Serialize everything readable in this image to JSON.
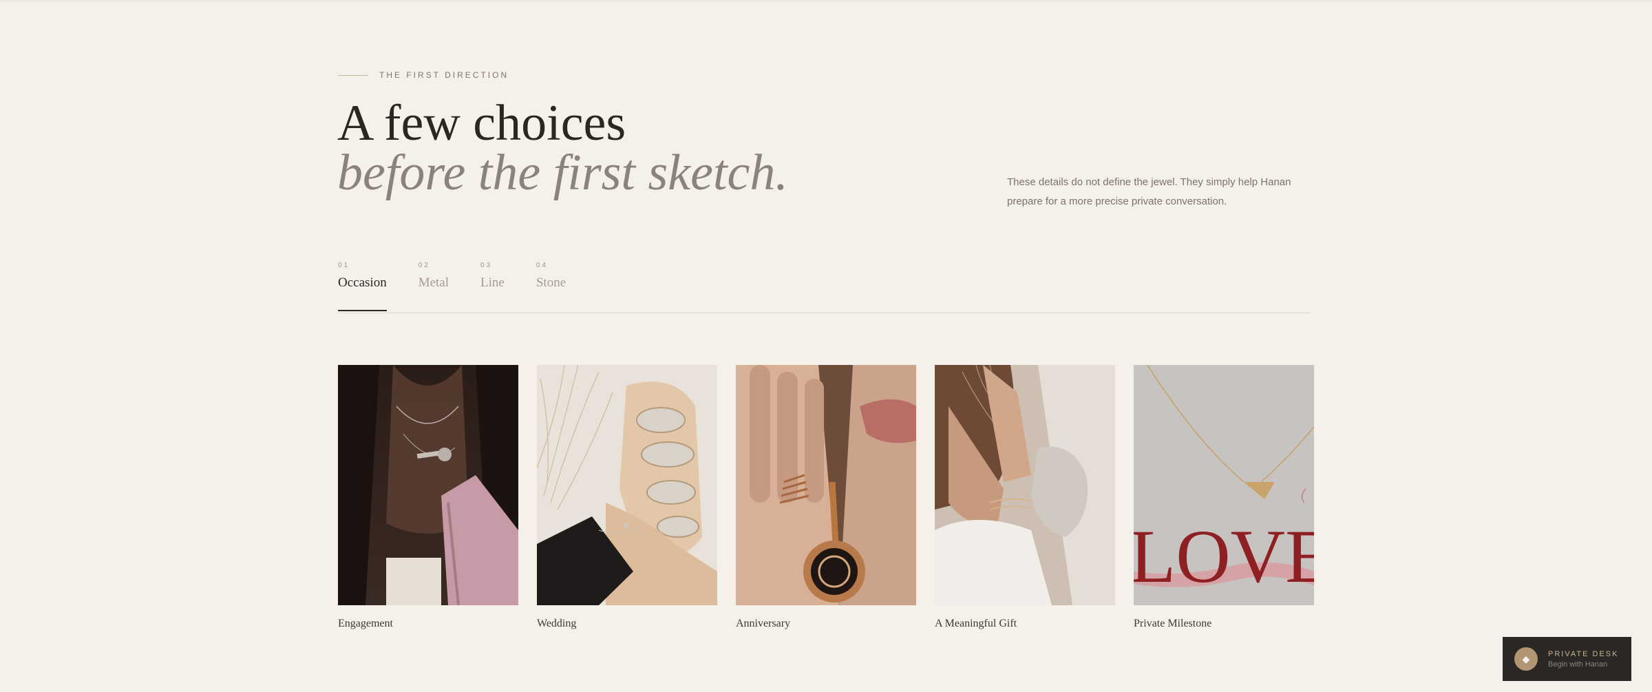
{
  "header": {
    "eyebrow": "THE FIRST DIRECTION",
    "title_line1": "A few choices",
    "title_line2": "before the first sketch.",
    "note": "These details do not define the jewel. They simply help Hanan prepare for a more precise private conversation."
  },
  "tabs": [
    {
      "num": "01",
      "label": "Occasion",
      "active": true
    },
    {
      "num": "02",
      "label": "Metal",
      "active": false
    },
    {
      "num": "03",
      "label": "Line",
      "active": false
    },
    {
      "num": "04",
      "label": "Stone",
      "active": false
    }
  ],
  "cards": [
    {
      "label": "Engagement",
      "image": "necklace-on-dark-sweater-photo"
    },
    {
      "label": "Wedding",
      "image": "anklet-and-sandals-photo"
    },
    {
      "label": "Anniversary",
      "image": "rings-and-watch-pendant-photo"
    },
    {
      "label": "A Meaningful Gift",
      "image": "bracelets-and-dried-grass-photo"
    },
    {
      "label": "Private Milestone",
      "image": "pendant-and-love-print-photo",
      "print_text": "LOVE"
    }
  ],
  "private_desk": {
    "title": "PRIVATE DESK",
    "subtitle": "Begin with Hanan",
    "icon": "diamond-icon"
  },
  "colors": {
    "background": "#f5f1ea",
    "text": "#2b2622",
    "muted_title": "#8a837c",
    "accent_rule": "#b9c193",
    "desk_bg": "#2a2724",
    "desk_badge": "#b29673",
    "love_print": "#8e1f22"
  }
}
